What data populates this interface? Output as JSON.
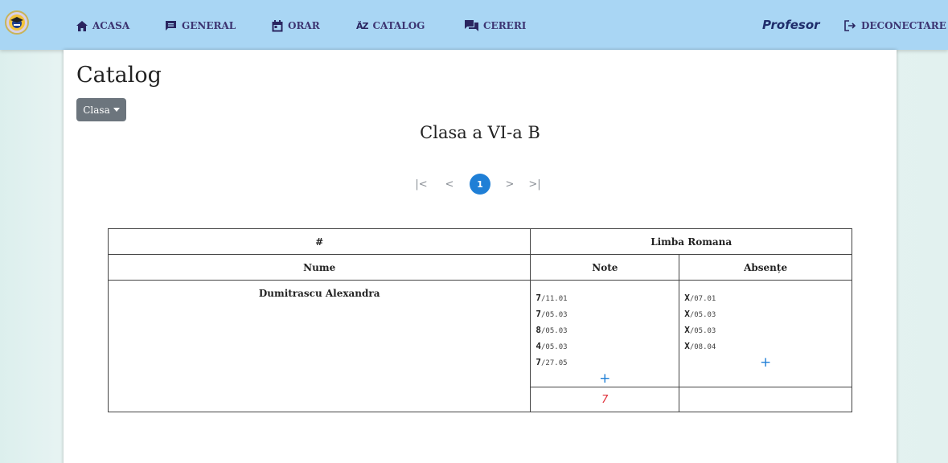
{
  "nav": {
    "items": [
      {
        "label": "ACASA",
        "icon": "home-icon"
      },
      {
        "label": "GENERAL",
        "icon": "message-icon"
      },
      {
        "label": "ORAR",
        "icon": "calendar-icon"
      },
      {
        "label": "CATALOG",
        "icon": "sort-az-icon"
      },
      {
        "label": "CERERI",
        "icon": "chat-icon"
      }
    ],
    "role": "Profesor",
    "logout": "DECONECTARE"
  },
  "page": {
    "title": "Catalog",
    "class_button": "Clasa",
    "class_heading": "Clasa a VI-a B"
  },
  "pagination": {
    "first": "|<",
    "prev": "<",
    "current": "1",
    "next": ">",
    "last": ">|"
  },
  "table": {
    "hash_header": "#",
    "subject": "Limba Romana",
    "name_header": "Nume",
    "grades_header": "Note",
    "absences_header": "Absențe",
    "rows": [
      {
        "name": "Dumitrascu Alexandra",
        "grades": [
          {
            "value": "7",
            "date": "/11.01"
          },
          {
            "value": "7",
            "date": "/05.03"
          },
          {
            "value": "8",
            "date": "/05.03"
          },
          {
            "value": "4",
            "date": "/05.03"
          },
          {
            "value": "7",
            "date": "/27.05"
          }
        ],
        "absences": [
          {
            "value": "X",
            "date": "/07.01"
          },
          {
            "value": "X",
            "date": "/05.03"
          },
          {
            "value": "X",
            "date": "/05.03"
          },
          {
            "value": "X",
            "date": "/08.04"
          }
        ],
        "add_grade": "+",
        "add_absence": "+",
        "average": "7"
      }
    ]
  },
  "colors": {
    "navbar": "#a9d6f4",
    "nav_text": "#3d3572",
    "accent": "#1f7fd6",
    "average": "#e0303a",
    "button": "#6c757d"
  }
}
